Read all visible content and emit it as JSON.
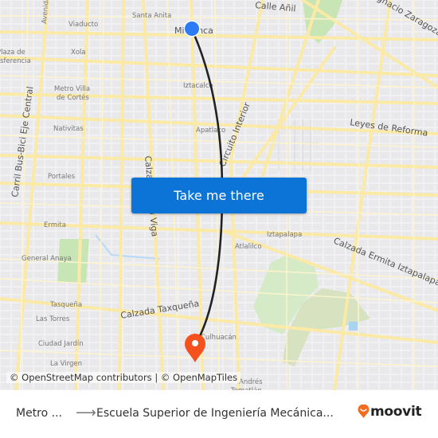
{
  "map": {
    "labels": {
      "calle_anil": "Calle Añil",
      "santa_anita": "Santa Anita",
      "viaducto": "Viaducto",
      "avenida": "Avenida",
      "mixiuhca": "Mixiuhca",
      "ignacio_zaragoza": "Ignacio Zaragoza",
      "xola": "Xola",
      "plaza_de_la_transferencia_1": "Plaza de",
      "plaza_de_la_transferencia_2": "Transferencia",
      "metro_villa_1": "Metro Villa",
      "metro_villa_2": "de Cortés",
      "iztacalco": "Iztacalco",
      "carril_bus_bici": "Carril Bus-Bici Eje Central",
      "nativitas": "Nativitas",
      "apatlaco": "Apatlaco",
      "circuito_interior": "Circuito Interior",
      "leyes_de_reforma": "Leyes de Reforma",
      "portales": "Portales",
      "calzada_de_la_viga": "Calzada de la Viga",
      "ermita": "Ermita",
      "iztapalapa": "Iztapalapa",
      "atlalilco": "Atlalilco",
      "calzada_ermita_iztapalapa": "Calzada Ermita Iztapalapa",
      "general_anaya": "General Anaya",
      "tasquena": "Tasqueña",
      "las_torres": "Las Torres",
      "calzada_taxquena": "Calzada Taxqueña",
      "ciudad_jardin": "Ciudad Jardín",
      "la_virgen": "La Virgen",
      "culhuacan": "Culhuacán",
      "san_andres_1": "Andrés",
      "san_andres_2": "Tomatlán"
    },
    "origin_marker_color": "#2d7cf6",
    "destination_marker_color": "#f4511e",
    "route_color": "#222222"
  },
  "cta": {
    "label": "Take me there",
    "color": "#0b74d6"
  },
  "attribution": "© OpenStreetMap contributors | © OpenMapTiles",
  "footer": {
    "origin": "Metro ...",
    "arrow": "⟶",
    "destination": "Escuela Superior de Ingeniería Mecánica...",
    "brand": "moovit",
    "brand_color": "#f26b21"
  }
}
